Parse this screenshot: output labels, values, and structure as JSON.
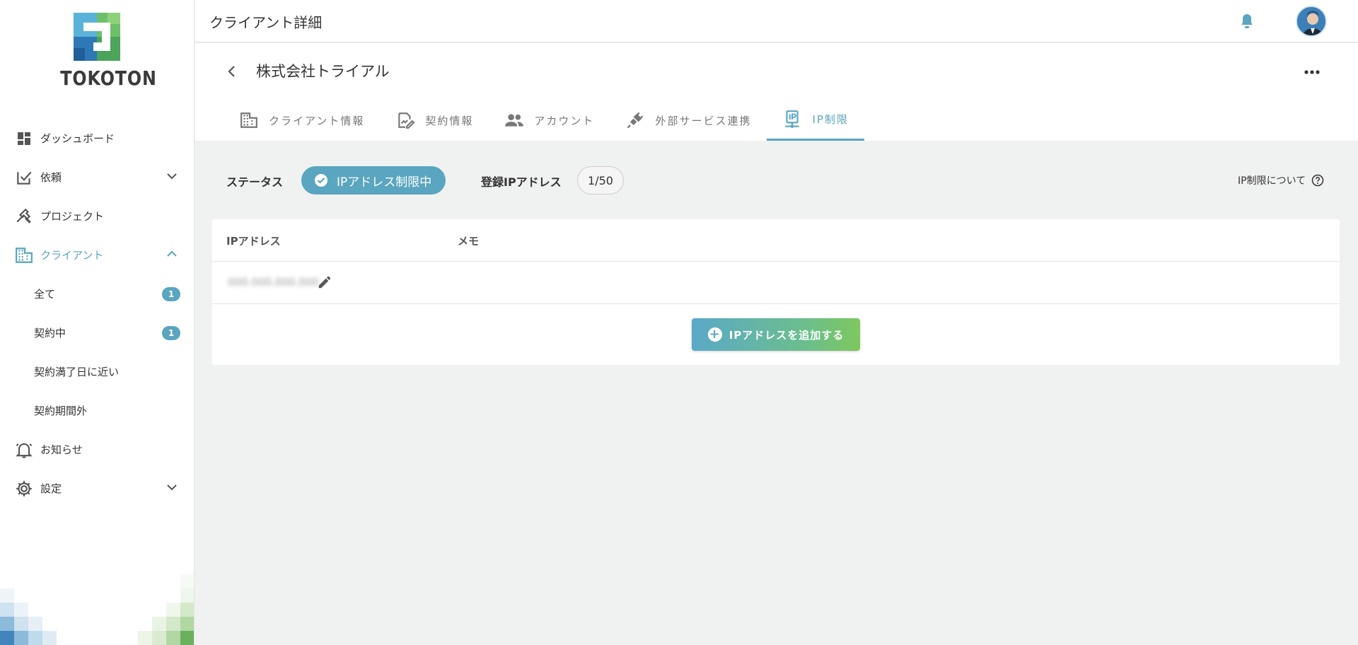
{
  "header": {
    "title": "クライアント詳細"
  },
  "brand": {
    "logo_text": "TOKOTON",
    "accent": "#5aa5bf",
    "green": "#7ec85d"
  },
  "sidebar": {
    "items": [
      {
        "label": "ダッシュボード",
        "icon": "dashboard-icon"
      },
      {
        "label": "依頼",
        "icon": "request-icon"
      },
      {
        "label": "プロジェクト",
        "icon": "tools-icon"
      },
      {
        "label": "クライアント",
        "icon": "building-icon"
      },
      {
        "label": "お知らせ",
        "icon": "bell-icon"
      },
      {
        "label": "設定",
        "icon": "gear-icon"
      }
    ],
    "client_sub": [
      {
        "label": "全て",
        "count": "1"
      },
      {
        "label": "契約中",
        "count": "1"
      },
      {
        "label": "契約満了日に近い"
      },
      {
        "label": "契約期間外"
      }
    ]
  },
  "client": {
    "name": "株式会社トライアル"
  },
  "tabs": [
    {
      "label": "クライアント情報",
      "icon": "building-icon"
    },
    {
      "label": "契約情報",
      "icon": "contract-icon"
    },
    {
      "label": "アカウント",
      "icon": "people-icon"
    },
    {
      "label": "外部サービス連携",
      "icon": "plug-icon"
    },
    {
      "label": "IP制限",
      "icon": "ip-icon"
    }
  ],
  "status": {
    "label": "ステータス",
    "value": "IPアドレス制限中",
    "registered_label": "登録IPアドレス",
    "registered_count": "1/50",
    "help": "IP制限について"
  },
  "table": {
    "columns": [
      "IPアドレス",
      "メモ"
    ],
    "rows": [
      {
        "ip": "000.000.000.000",
        "memo": ""
      }
    ],
    "add_button": "IPアドレスを追加する"
  }
}
